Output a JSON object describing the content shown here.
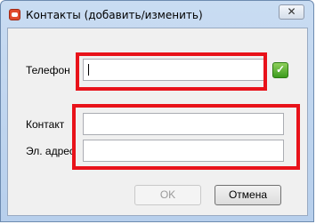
{
  "window": {
    "title": "Контакты (добавить/изменить)",
    "close_symbol": "✕",
    "app_icon": "phone-book-icon"
  },
  "form": {
    "phone": {
      "label": "Телефон",
      "value": "",
      "confirm_icon": "check-icon",
      "confirm_symbol": "✓"
    },
    "contact": {
      "label": "Контакт",
      "value": ""
    },
    "email": {
      "label": "Эл. адрес",
      "value": ""
    }
  },
  "buttons": {
    "ok_label": "OK",
    "cancel_label": "Отмена"
  },
  "colors": {
    "highlight": "#e8121a",
    "confirm_green": "#3c9b1e"
  }
}
